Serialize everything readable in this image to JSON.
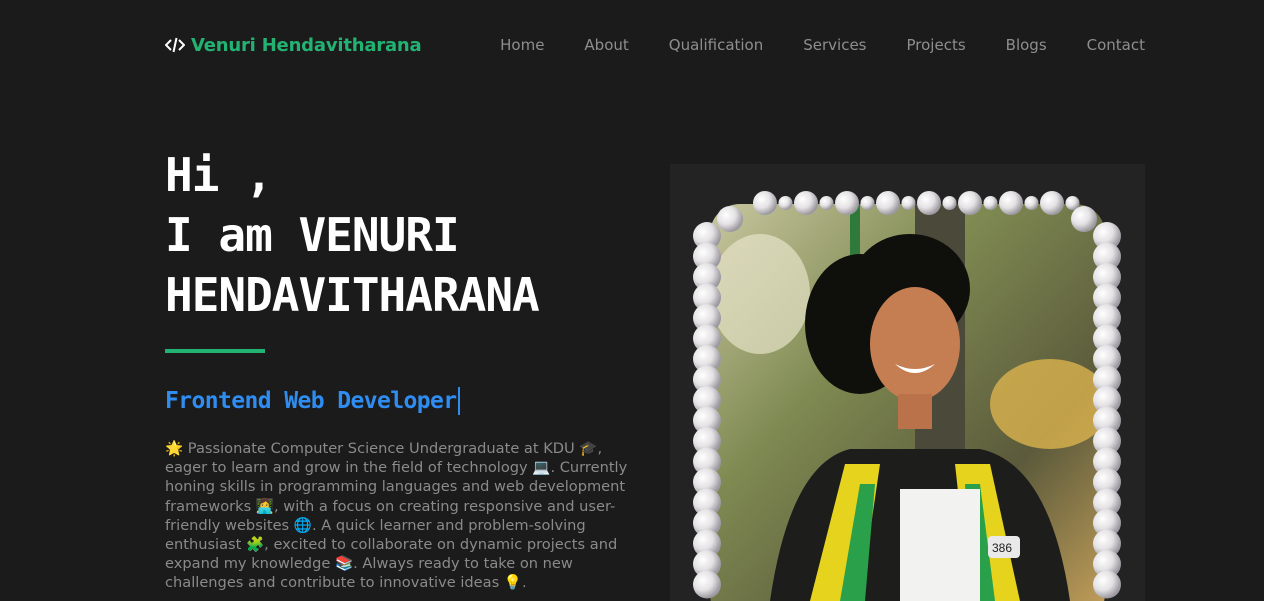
{
  "brand": {
    "icon": "code-icon",
    "name": "Venuri Hendavitharana",
    "color": "#22b373"
  },
  "nav": {
    "items": [
      {
        "label": "Home"
      },
      {
        "label": "About"
      },
      {
        "label": "Qualification"
      },
      {
        "label": "Services"
      },
      {
        "label": "Projects"
      },
      {
        "label": "Blogs"
      },
      {
        "label": "Contact"
      }
    ]
  },
  "hero": {
    "greeting_line1": "Hi ,",
    "greeting_line2": "I am VENURI",
    "greeting_line3": "HENDAVITHARANA",
    "role": "Frontend Web Developer",
    "role_color": "#2f8df2",
    "bio": "🌟 Passionate Computer Science Undergraduate at KDU 🎓, eager to learn and grow in the field of technology 💻. Currently honing skills in programming languages and web development frameworks 👩‍💻, with a focus on creating responsive and user-friendly websites 🌐. A quick learner and problem-solving enthusiast 🧩, excited to collaborate on dynamic projects and expand my knowledge 📚. Always ready to take on new challenges and contribute to innovative ideas 💡."
  },
  "photo": {
    "frame": "pearl-frame",
    "badge_number": "386"
  }
}
